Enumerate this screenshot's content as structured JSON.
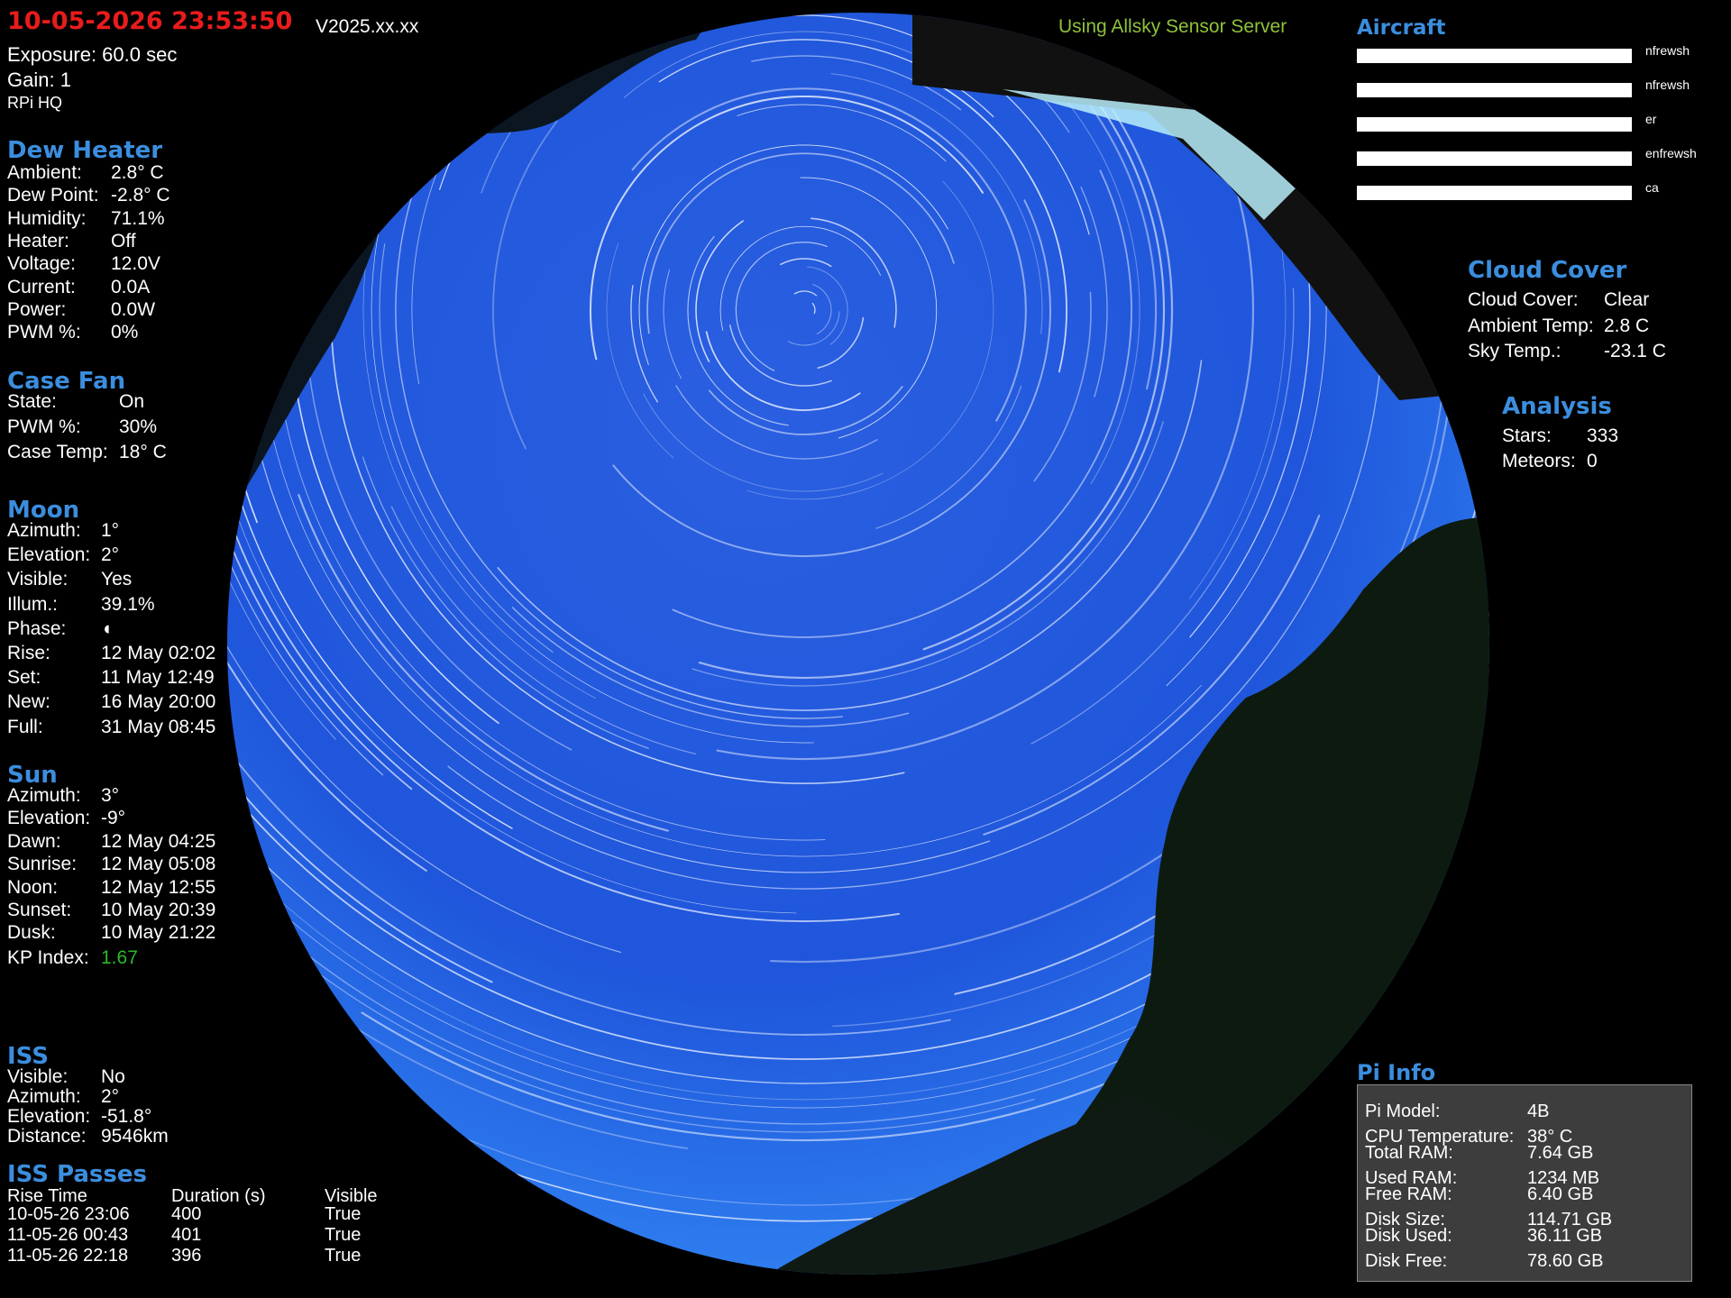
{
  "header": {
    "datetime": "10-05-2026 23:53:50",
    "version": "V2025.xx.xx",
    "server_note": "Using Allsky Sensor Server",
    "exposure": "Exposure: 60.0 sec",
    "gain": "Gain: 1",
    "camera": "RPi  HQ"
  },
  "dew_heater": {
    "title": "Dew Heater",
    "rows": [
      {
        "label": "Ambient:",
        "value": "2.8° C"
      },
      {
        "label": "Dew Point:",
        "value": "-2.8° C"
      },
      {
        "label": "Humidity:",
        "value": "71.1%"
      },
      {
        "label": "Heater:",
        "value": "Off"
      },
      {
        "label": "Voltage:",
        "value": "12.0V"
      },
      {
        "label": "Current:",
        "value": "0.0A"
      },
      {
        "label": "Power:",
        "value": "0.0W"
      },
      {
        "label": "PWM %:",
        "value": "0%"
      }
    ]
  },
  "case_fan": {
    "title": "Case Fan",
    "rows": [
      {
        "label": "State:",
        "value": "On"
      },
      {
        "label": "PWM %:",
        "value": "30%"
      },
      {
        "label": "Case Temp:",
        "value": "18° C"
      }
    ]
  },
  "moon": {
    "title": "Moon",
    "rows": [
      {
        "label": "Azimuth:",
        "value": "1°"
      },
      {
        "label": "Elevation:",
        "value": "2°"
      },
      {
        "label": "Visible:",
        "value": "Yes"
      },
      {
        "label": "Illum.:",
        "value": "39.1%"
      },
      {
        "label": "Phase:",
        "value": "◖"
      },
      {
        "label": "Rise:",
        "value": "12 May 02:02"
      },
      {
        "label": "Set:",
        "value": "11 May 12:49"
      },
      {
        "label": "New:",
        "value": "16 May 20:00"
      },
      {
        "label": "Full:",
        "value": "31 May 08:45"
      }
    ]
  },
  "sun": {
    "title": "Sun",
    "rows": [
      {
        "label": "Azimuth:",
        "value": "3°"
      },
      {
        "label": "Elevation:",
        "value": "-9°"
      },
      {
        "label": "Dawn:",
        "value": "12 May 04:25"
      },
      {
        "label": "Sunrise:",
        "value": "12 May 05:08"
      },
      {
        "label": "Noon:",
        "value": "12 May 12:55"
      },
      {
        "label": "Sunset:",
        "value": "10 May 20:39"
      },
      {
        "label": "Dusk:",
        "value": "10 May 21:22"
      }
    ],
    "kp_label": "KP Index:",
    "kp_value": "1.67",
    "kp_color": "#2db82d"
  },
  "iss": {
    "title": "ISS",
    "rows": [
      {
        "label": "Visible:",
        "value": "No"
      },
      {
        "label": "Azimuth:",
        "value": "2°"
      },
      {
        "label": "Elevation:",
        "value": "-51.8°"
      },
      {
        "label": "Distance:",
        "value": "9546km"
      }
    ]
  },
  "iss_passes": {
    "title": "ISS Passes",
    "headers": [
      "Rise Time",
      "Duration (s)",
      "Visible"
    ],
    "rows": [
      [
        "10-05-26 23:06",
        "400",
        "True"
      ],
      [
        "11-05-26 00:43",
        "401",
        "True"
      ],
      [
        "11-05-26 22:18",
        "396",
        "True"
      ]
    ]
  },
  "aircraft": {
    "title": "Aircraft",
    "rows": [
      "nfrewsh",
      "nfrewsh",
      "er",
      "enfrewsh",
      "ca"
    ]
  },
  "cloud_cover": {
    "title": "Cloud Cover",
    "rows": [
      {
        "label": "Cloud Cover:",
        "value": "Clear"
      },
      {
        "label": "Ambient Temp:",
        "value": "2.8 C"
      },
      {
        "label": "Sky Temp.:",
        "value": "-23.1 C"
      }
    ]
  },
  "analysis": {
    "title": "Analysis",
    "rows": [
      {
        "label": "Stars:",
        "value": "333"
      },
      {
        "label": "Meteors:",
        "value": "0"
      }
    ]
  },
  "pi_info": {
    "title": "Pi Info",
    "rows": [
      {
        "label": "Pi Model:",
        "value": "4B"
      },
      {
        "label": "CPU Temperature:",
        "value": "38° C"
      },
      {
        "label": "Total RAM:",
        "value": "7.64 GB"
      },
      {
        "label": "Used RAM:",
        "value": "1234 MB"
      },
      {
        "label": "Free RAM:",
        "value": "6.40 GB"
      },
      {
        "label": "Disk Size:",
        "value": "114.71 GB"
      },
      {
        "label": "Disk Used:",
        "value": "36.11 GB"
      },
      {
        "label": "Disk Free:",
        "value": "78.60 GB"
      }
    ]
  },
  "colors": {
    "header_blue": "#3b8ede",
    "datetime_red": "#e81c1c",
    "server_green": "#8fc23a",
    "sky_blue": "#1e55d6"
  }
}
